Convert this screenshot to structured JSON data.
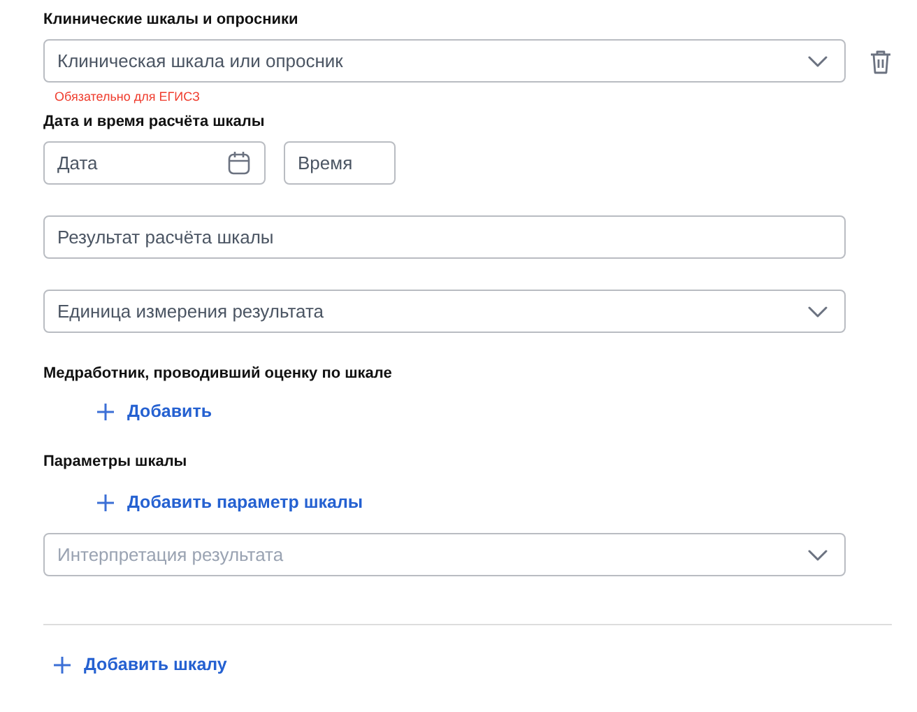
{
  "scale_section": {
    "label": "Клинические шкалы и опросники",
    "scale_select": {
      "placeholder": "Клиническая шкала или опросник",
      "disabled": false
    },
    "error": "Обязательно для ЕГИСЗ"
  },
  "datetime": {
    "label": "Дата и время расчёта шкалы",
    "date": {
      "placeholder": "Дата"
    },
    "time": {
      "placeholder": "Время"
    }
  },
  "result": {
    "placeholder": "Результат расчёта шкалы"
  },
  "unit_select": {
    "placeholder": "Единица измерения результата",
    "disabled": false
  },
  "staff": {
    "label": "Медработник, проводивший оценку по шкале",
    "add_link": "Добавить"
  },
  "params": {
    "label": "Параметры шкалы",
    "add_link": "Добавить параметр шкалы"
  },
  "interpretation_select": {
    "placeholder": "Интерпретация результата",
    "disabled": true
  },
  "add_scale_link": "Добавить шкалу"
}
